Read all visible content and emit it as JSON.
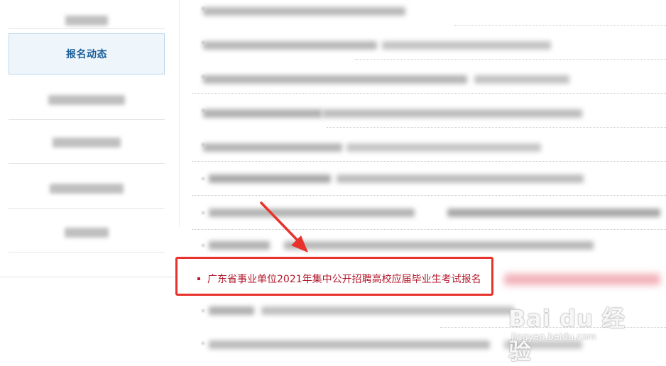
{
  "sidebar": {
    "active_item_label": "报名动态"
  },
  "highlighted_item": {
    "title": "广东省事业单位2021年集中公开招聘高校应届毕业生考试报名"
  },
  "watermark": {
    "logo_text": "Bai du 经验",
    "url_text": "jingyan.baidu.com"
  },
  "colors": {
    "accent_blue": "#1b5f9a",
    "highlight_red": "#b2182b",
    "annotation_red": "#e8312b"
  }
}
